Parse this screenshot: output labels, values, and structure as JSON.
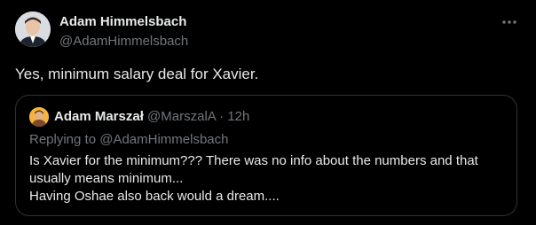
{
  "tweet": {
    "author_name": "Adam Himmelsbach",
    "author_handle": "@AdamHimmelsbach",
    "text": "Yes, minimum salary deal for Xavier.",
    "more_icon": "ellipsis-icon"
  },
  "quote": {
    "author_name": "Adam Marszał",
    "author_handle": "@MarszalA",
    "separator": "·",
    "time": "12h",
    "replying_to": "Replying to @AdamHimmelsbach",
    "lines": [
      "Is Xavier for the minimum??? There was no info about the numbers and that",
      "usually means minimum...",
      "Having Oshae also back would a dream...."
    ]
  },
  "colors": {
    "background": "#000000",
    "primary_text": "#e7e9ea",
    "secondary_text": "#71767b",
    "border": "#2f3336"
  }
}
